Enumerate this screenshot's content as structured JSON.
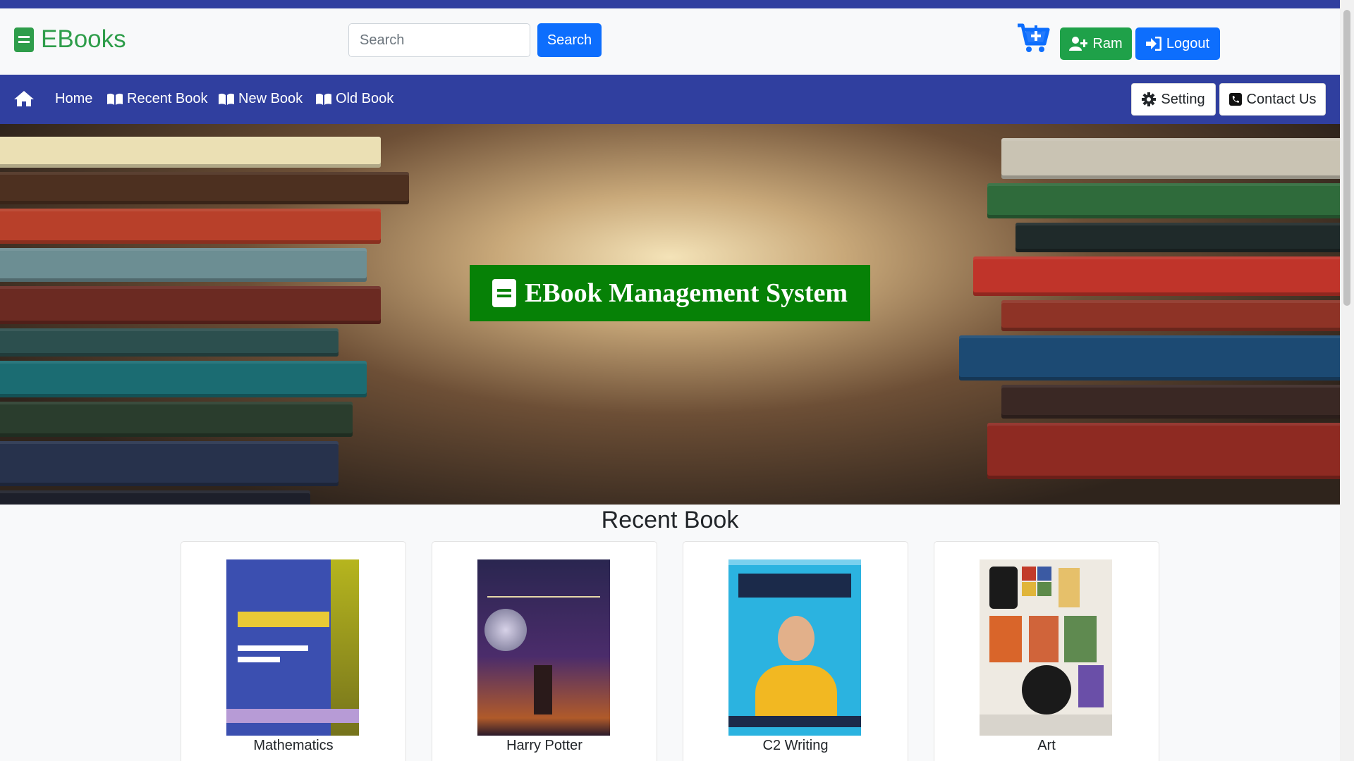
{
  "header": {
    "brand": "EBooks",
    "search_placeholder": "Search",
    "search_button": "Search",
    "user_button": "Ram",
    "logout_button": "Logout"
  },
  "nav": {
    "items": [
      {
        "label": "Home"
      },
      {
        "label": "Recent Book"
      },
      {
        "label": "New Book"
      },
      {
        "label": "Old Book"
      }
    ],
    "setting": "Setting",
    "contact": "Contact Us"
  },
  "hero": {
    "title": "EBook Management System"
  },
  "recent": {
    "heading": "Recent Book",
    "books": [
      {
        "title": "Mathematics"
      },
      {
        "title": "Harry Potter"
      },
      {
        "title": "C2 Writing"
      },
      {
        "title": "Art"
      }
    ]
  },
  "colors": {
    "primary_blue": "#0d6efd",
    "navbar": "#303f9f",
    "brand_green": "#2e9d4a",
    "hero_title_bg": "#068106"
  }
}
